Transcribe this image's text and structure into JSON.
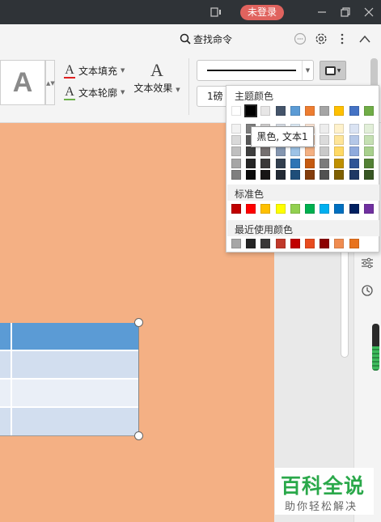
{
  "titlebar": {
    "login_label": "未登录",
    "icons": [
      "window-mode-icon",
      "minimize-icon",
      "restore-icon",
      "close-icon"
    ]
  },
  "menubar": {
    "find_command": "查找命令",
    "icons": [
      "search-icon",
      "chat-icon",
      "settings-icon",
      "more-icon",
      "collapse-icon"
    ]
  },
  "ribbon": {
    "style_preview": "A",
    "text_fill": "文本填充",
    "text_outline": "文本轮廓",
    "text_effect": "文本效果",
    "effect_glyph": "A",
    "line_weight": "1磅",
    "colors": {
      "fill_bar": "#e02020",
      "outline_bar": "#6bb04a"
    }
  },
  "color_popup": {
    "theme_title": "主题颜色",
    "standard_title": "标准色",
    "recent_title": "最近使用颜色",
    "tooltip": "黑色, 文本1",
    "theme_top": [
      "#ffffff",
      "#000000",
      "#e7e6e6",
      "#44546a",
      "#5b9bd5",
      "#ed7d31",
      "#a5a5a5",
      "#ffc000",
      "#4472c4",
      "#70ad47"
    ],
    "theme_shades": [
      [
        "#f2f2f2",
        "#7f7f7f",
        "#d0cece",
        "#d6dce4",
        "#deebf6",
        "#fbe5d5",
        "#ededed",
        "#fff2cc",
        "#dae3f3",
        "#e2efd9"
      ],
      [
        "#d9d9d9",
        "#595959",
        "#aeaaaa",
        "#adb9ca",
        "#bdd7ee",
        "#f7cbac",
        "#dbdbdb",
        "#fee599",
        "#b4c7e7",
        "#c5e0b3"
      ],
      [
        "#bfbfbf",
        "#3f3f3f",
        "#757070",
        "#8496b0",
        "#9dc3e6",
        "#f4b183",
        "#c9c9c9",
        "#ffd965",
        "#8faadc",
        "#a8d08d"
      ],
      [
        "#a6a6a6",
        "#262626",
        "#3a3838",
        "#323f4f",
        "#2e75b5",
        "#c55a11",
        "#7b7b7b",
        "#bf9000",
        "#2f5496",
        "#538135"
      ],
      [
        "#7f7f7f",
        "#0c0c0c",
        "#171616",
        "#222a35",
        "#1f4e79",
        "#833c0b",
        "#525252",
        "#7f6000",
        "#1f3864",
        "#375623"
      ]
    ],
    "standard": [
      "#c00000",
      "#ff0000",
      "#ffc000",
      "#ffff00",
      "#92d050",
      "#00b050",
      "#00b0f0",
      "#0070c0",
      "#002060",
      "#7030a0"
    ],
    "recent": [
      "#a6a6a6",
      "#262626",
      "#3a3838",
      "#c0392b",
      "#c00000",
      "#e84c1f",
      "#8b0000",
      "#f08c50",
      "#e8731e"
    ]
  },
  "slide": {
    "background": "#f4b084",
    "table_header_color": "#5b9bd5",
    "table_row_colors": [
      "#d2deef",
      "#eaeff7",
      "#d2deef"
    ]
  },
  "watermark": {
    "title": "百科全说",
    "subtitle": "助你轻松解决"
  }
}
